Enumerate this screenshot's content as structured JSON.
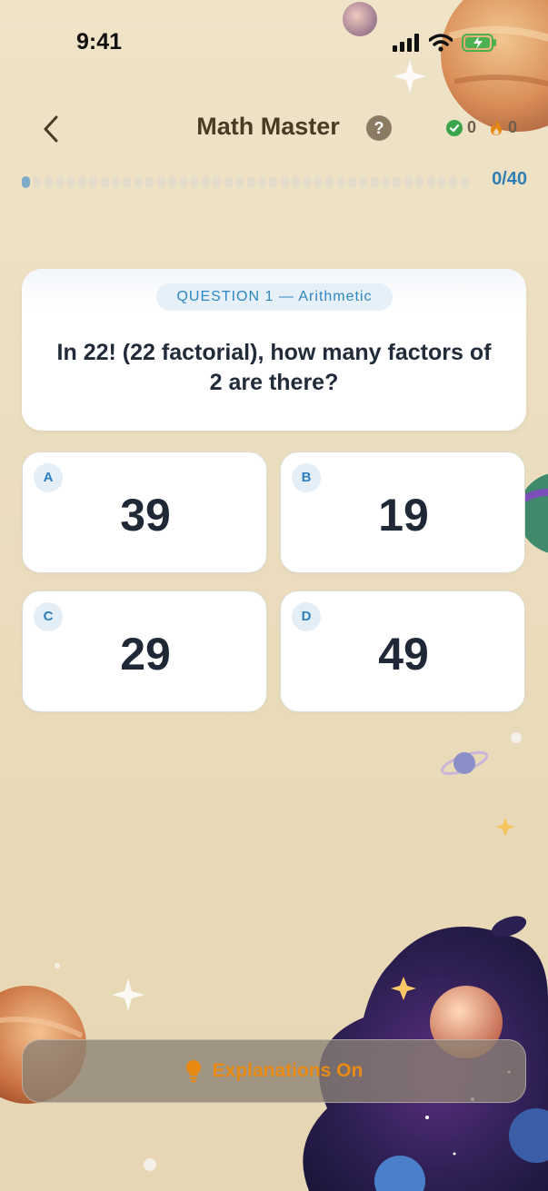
{
  "status_bar": {
    "time": "9:41",
    "icons": [
      "signal-icon",
      "wifi-icon",
      "battery-charging-icon"
    ]
  },
  "header": {
    "title": "Math Master",
    "help_label": "?",
    "correct_count": "0",
    "streak_count": "0",
    "icons": [
      "back-chevron-icon",
      "help-icon",
      "check-circle-icon",
      "flame-icon"
    ]
  },
  "progress": {
    "current": 0,
    "total": 40,
    "label": "0/40"
  },
  "question": {
    "badge": "QUESTION 1 — Arithmetic",
    "text": "In 22! (22 factorial), how many factors of 2 are there?"
  },
  "answers": [
    {
      "letter": "A",
      "value": "39"
    },
    {
      "letter": "B",
      "value": "19"
    },
    {
      "letter": "C",
      "value": "29"
    },
    {
      "letter": "D",
      "value": "49"
    }
  ],
  "footer": {
    "explanations_label": "Explanations On",
    "icon": "lightbulb-icon"
  },
  "colors": {
    "accent_blue": "#2e86c1",
    "accent_orange": "#e98b12",
    "correct_green": "#3aa54a",
    "flame_orange": "#e8870f",
    "background": "#eadcbc"
  }
}
